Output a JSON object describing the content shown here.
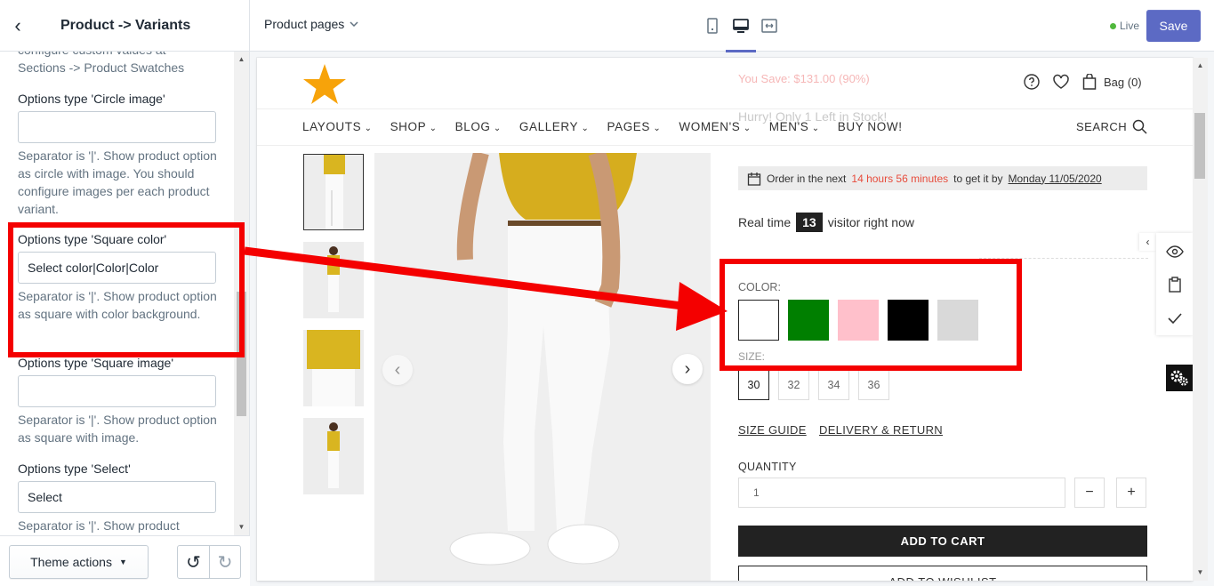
{
  "sidebar": {
    "title": "Product -> Variants",
    "intro_text": "configure custom values at Sections -> Product Swatches",
    "options": [
      {
        "label": "Options type 'Circle image'",
        "value": "",
        "help": "Separator is '|'. Show product option as circle with image. You should configure images per each product variant."
      },
      {
        "label": "Options type 'Square color'",
        "value": "Select color|Color|Color",
        "help": "Separator is '|'. Show product option as square with color background."
      },
      {
        "label": "Options type 'Square image'",
        "value": "",
        "help": "Separator is '|'. Show product option as square with image."
      },
      {
        "label": "Options type 'Select'",
        "value": "Select",
        "help": "Separator is '|'. Show product"
      }
    ],
    "theme_actions_label": "Theme actions"
  },
  "topbar": {
    "page_select": "Product pages",
    "live_label": "Live",
    "save_label": "Save"
  },
  "store": {
    "faded_save_text": "You Save: $131.00 (90%)",
    "faded_stock_text": "Hurry! Only 1 Left in Stock!",
    "bag_label": "Bag (0)",
    "nav": [
      "LAYOUTS",
      "SHOP",
      "BLOG",
      "GALLERY",
      "PAGES",
      "WOMEN'S",
      "MEN'S",
      "BUY NOW!"
    ],
    "search_label": "SEARCH",
    "order": {
      "prefix": "Order in the next",
      "countdown": "14 hours 56 minutes",
      "middle": "to get it by",
      "date": "Monday 11/05/2020"
    },
    "visitors": {
      "prefix": "Real time",
      "count": "13",
      "suffix": "visitor right now"
    },
    "color_label": "COLOR:",
    "colors": [
      "#ffffff",
      "#007f00",
      "#ffc0cb",
      "#000000",
      "#d9d9d9"
    ],
    "size_label": "SIZE:",
    "sizes": [
      "30",
      "32",
      "34",
      "36"
    ],
    "size_guide": "SIZE GUIDE",
    "delivery_return": "DELIVERY & RETURN",
    "quantity_label": "QUANTITY",
    "quantity_value": "1",
    "add_to_cart": "ADD TO CART",
    "add_to_wishlist": "ADD TO WISHLIST"
  },
  "colors": {
    "accent": "#5c6ac4",
    "annotation": "#f40000",
    "live_dot": "#50b83c",
    "countdown": "#e74c3c"
  }
}
